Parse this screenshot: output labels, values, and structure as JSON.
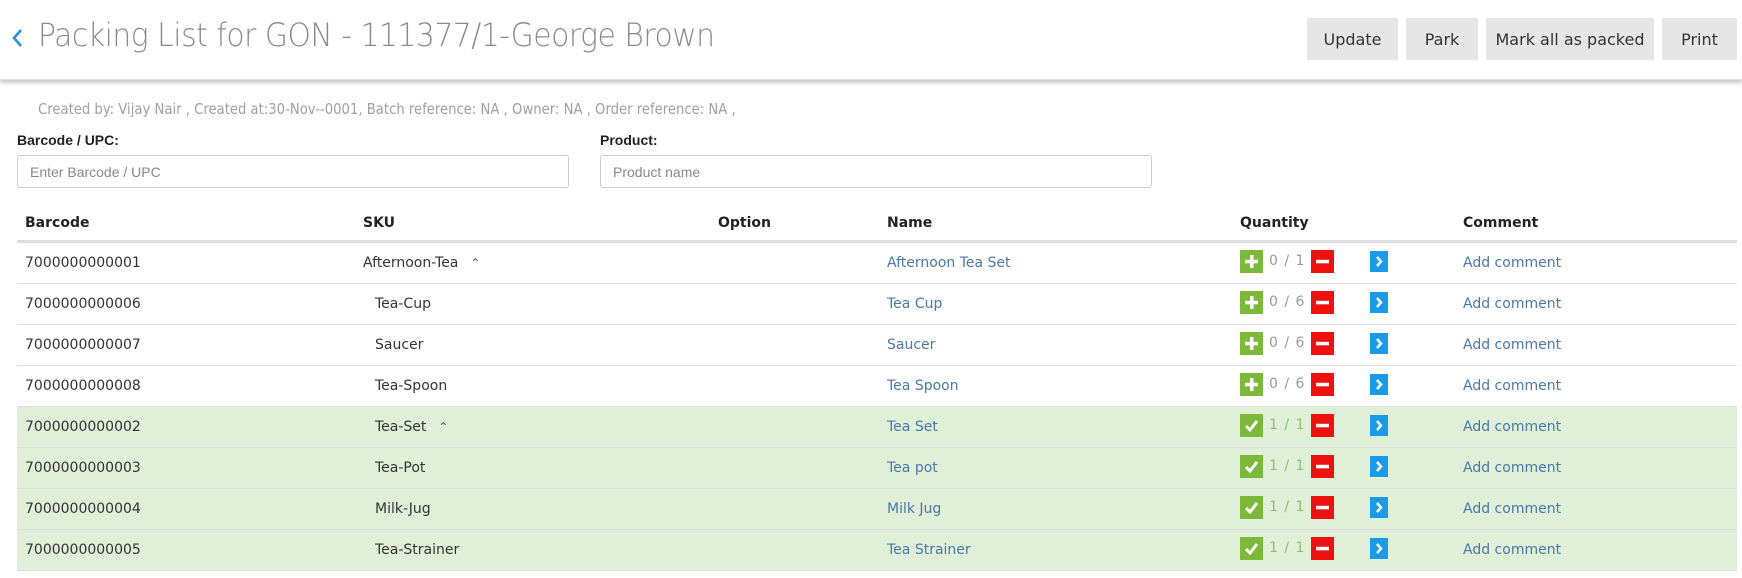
{
  "header": {
    "title": "Packing List for GON - 111377/1-George Brown",
    "buttons": {
      "update": "Update",
      "park": "Park",
      "mark_all": "Mark all as packed",
      "print": "Print"
    }
  },
  "meta": "Created by: Vijay Nair , Created at:30-Nov--0001, Batch reference: NA , Owner: NA , Order reference: NA ,",
  "filters": {
    "barcode_label": "Barcode / UPC:",
    "barcode_placeholder": "Enter Barcode / UPC",
    "barcode_value": "",
    "product_label": "Product:",
    "product_placeholder": "Product name",
    "product_value": ""
  },
  "table": {
    "columns": [
      "Barcode",
      "SKU",
      "Option",
      "Name",
      "Quantity",
      "",
      "Comment"
    ],
    "rows": [
      {
        "barcode": "7000000000001",
        "sku": "Afternoon-Tea",
        "parent": true,
        "child": false,
        "option": "",
        "name": "Afternoon Tea Set",
        "qty": "0 / 1",
        "packed": false,
        "comment": "Add comment"
      },
      {
        "barcode": "7000000000006",
        "sku": "Tea-Cup",
        "parent": false,
        "child": true,
        "option": "",
        "name": "Tea Cup",
        "qty": "0 / 6",
        "packed": false,
        "comment": "Add comment"
      },
      {
        "barcode": "7000000000007",
        "sku": "Saucer",
        "parent": false,
        "child": true,
        "option": "",
        "name": "Saucer",
        "qty": "0 / 6",
        "packed": false,
        "comment": "Add comment"
      },
      {
        "barcode": "7000000000008",
        "sku": "Tea-Spoon",
        "parent": false,
        "child": true,
        "option": "",
        "name": "Tea Spoon",
        "qty": "0 / 6",
        "packed": false,
        "comment": "Add comment"
      },
      {
        "barcode": "7000000000002",
        "sku": "Tea-Set",
        "parent": true,
        "child": true,
        "option": "",
        "name": "Tea Set",
        "qty": "1 / 1",
        "packed": true,
        "comment": "Add comment"
      },
      {
        "barcode": "7000000000003",
        "sku": "Tea-Pot",
        "parent": false,
        "child": true,
        "option": "",
        "name": "Tea pot",
        "qty": "1 / 1",
        "packed": true,
        "comment": "Add comment"
      },
      {
        "barcode": "7000000000004",
        "sku": "Milk-Jug",
        "parent": false,
        "child": true,
        "option": "",
        "name": "Milk Jug",
        "qty": "1 / 1",
        "packed": true,
        "comment": "Add comment"
      },
      {
        "barcode": "7000000000005",
        "sku": "Tea-Strainer",
        "parent": false,
        "child": true,
        "option": "",
        "name": "Tea Strainer",
        "qty": "1 / 1",
        "packed": true,
        "comment": "Add comment"
      }
    ]
  },
  "colors": {
    "accent_link": "#4a78a8",
    "packed_row": "#dfefd8",
    "plus_green": "#7cb93b",
    "minus_red": "#ef1010",
    "arrow_blue": "#1a9be9"
  }
}
